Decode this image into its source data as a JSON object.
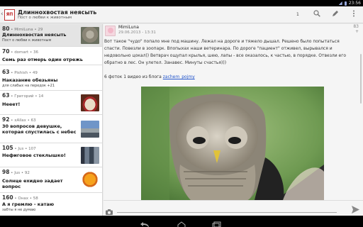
{
  "statusbar": {
    "time": "23:56"
  },
  "actionbar": {
    "logo_text": "ЯП",
    "title": "Длиннохвостая неясыть",
    "subtitle": "Пост о любви к животным",
    "badge": "1",
    "icons": [
      "search-icon",
      "edit-icon",
      "overflow-menu-icon"
    ]
  },
  "list": {
    "items": [
      {
        "score": "80",
        "author": "MimiLuna",
        "comments": "29",
        "title": "Длиннохвостая неясыть",
        "sub": "Пост о любви к животным"
      },
      {
        "score": "70",
        "author": "domart",
        "comments": "36",
        "title": "Семь раз отмерь один отрежь",
        "sub": ""
      },
      {
        "score": "63",
        "author": "Pishish",
        "comments": "49",
        "title": "Наказание обезьяны",
        "sub": "для слабых на передок +21"
      },
      {
        "score": "63",
        "author": "Григорий",
        "comments": "14",
        "title": "Нееет!",
        "sub": ""
      },
      {
        "score": "92",
        "author": "xAllax",
        "comments": "63",
        "title": "30 вопросов девушке, которая спустилась с небес",
        "sub": ""
      },
      {
        "score": "105",
        "author": "Jus",
        "comments": "107",
        "title": "Нефиговое стеклышко!",
        "sub": ""
      },
      {
        "score": "98",
        "author": "Jus",
        "comments": "92",
        "title": "Солнце ехидно задает вопрос",
        "sub": ""
      },
      {
        "score": "160",
        "author": "Онах",
        "comments": "58",
        "title": "А я гремлю - катаю",
        "sub": "забты я не думаю"
      }
    ]
  },
  "post": {
    "author": "MimiLuna",
    "date": "29.06.2013 - 13:31",
    "score": "83",
    "score_sign": "+",
    "body": "Вот такое \"чудо\" попало мне под машину. Лежал на дороге и тяжело дышал. Решено было попытаться спасти. Повезли в зоопарк. Впопыхах наши ветеринара. По дороге \"пациент\" отживел, вырывался и недовольно цокал)) Ветврач ощупал крылья, шею, лапы - все оказалось, к частью, в порядке. Отвезли его обратно в лес. Он улетел. Занавес. Минуты счастья)))",
    "photos_prefix": "6 фоток 1 видео из блога ",
    "photos_link": "zachem_pojmy"
  },
  "reply": {
    "placeholder": "",
    "value": ""
  },
  "colors": {
    "link": "#2255cc",
    "accent_red": "#b22222"
  }
}
